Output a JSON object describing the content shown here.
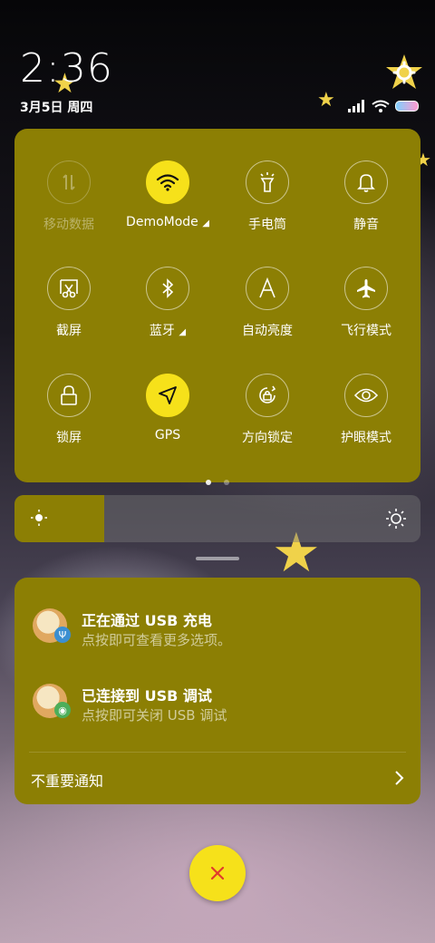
{
  "status_bar": {
    "time": "2:36",
    "date": "3月5日 周四",
    "icons": [
      "signal-icon",
      "wifi-icon",
      "battery-icon"
    ]
  },
  "quick_settings": {
    "tiles": [
      {
        "label": "移动数据",
        "icon": "mobile-data-icon",
        "state": "disabled"
      },
      {
        "label": "DemoMode",
        "icon": "wifi-icon",
        "state": "on",
        "has_more": true
      },
      {
        "label": "手电筒",
        "icon": "flashlight-icon",
        "state": "off"
      },
      {
        "label": "静音",
        "icon": "bell-icon",
        "state": "off"
      },
      {
        "label": "截屏",
        "icon": "screenshot-icon",
        "state": "off"
      },
      {
        "label": "蓝牙",
        "icon": "bluetooth-icon",
        "state": "off",
        "has_more": true
      },
      {
        "label": "自动亮度",
        "icon": "auto-brightness-icon",
        "state": "off"
      },
      {
        "label": "飞行模式",
        "icon": "airplane-icon",
        "state": "off"
      },
      {
        "label": "锁屏",
        "icon": "lock-icon",
        "state": "off"
      },
      {
        "label": "GPS",
        "icon": "location-icon",
        "state": "on"
      },
      {
        "label": "方向锁定",
        "icon": "rotation-lock-icon",
        "state": "off"
      },
      {
        "label": "护眼模式",
        "icon": "eye-icon",
        "state": "off"
      }
    ],
    "page_count": 2,
    "current_page": 1
  },
  "brightness": {
    "level": 0.22
  },
  "notifications": [
    {
      "title": "正在通过 USB 充电",
      "body": "点按即可查看更多选项。",
      "badge": "usb-icon",
      "badge_color": "#3b8fd1"
    },
    {
      "title": "已连接到 USB 调试",
      "body": "点按即可关闭 USB 调试",
      "badge": "android-icon",
      "badge_color": "#4cae5a"
    }
  ],
  "unimportant": {
    "label": "不重要通知"
  },
  "colors": {
    "accent": "#f6e11a",
    "panel": "#8c7f04"
  }
}
